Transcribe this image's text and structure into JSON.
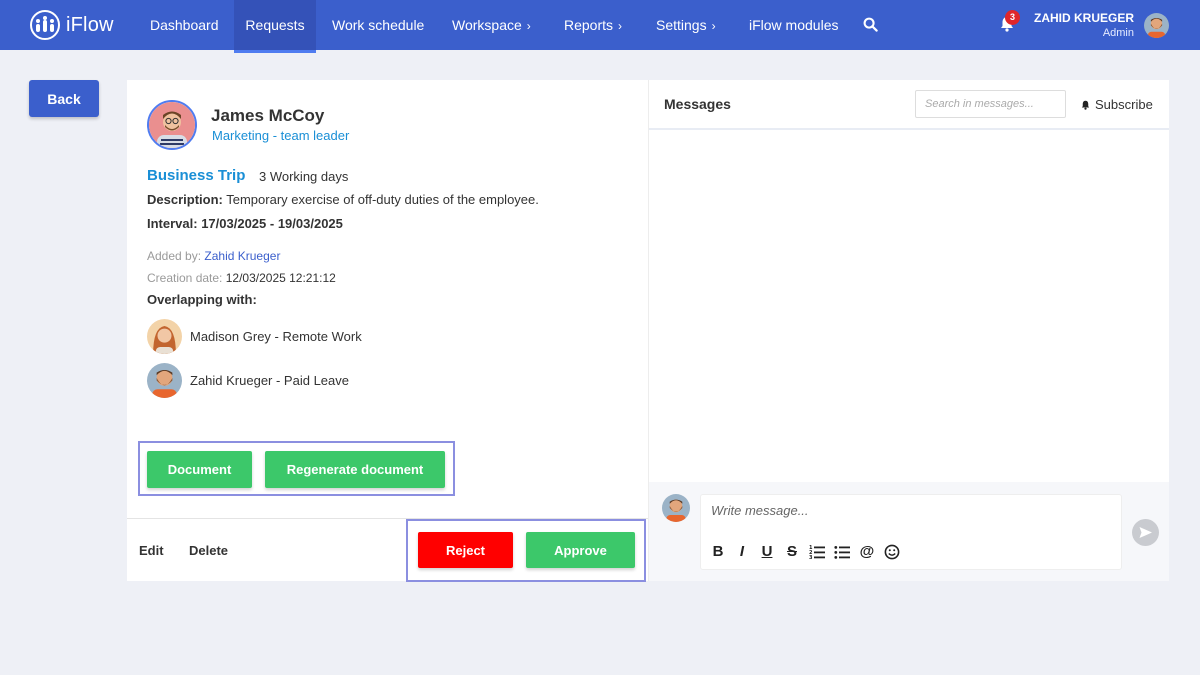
{
  "app": {
    "name": "iFlow"
  },
  "nav": {
    "items": [
      {
        "label": "Dashboard",
        "has_chevron": false,
        "active": false
      },
      {
        "label": "Requests",
        "has_chevron": false,
        "active": true
      },
      {
        "label": "Work schedule",
        "has_chevron": false,
        "active": false
      },
      {
        "label": "Workspace",
        "has_chevron": true,
        "active": false
      },
      {
        "label": "Reports",
        "has_chevron": true,
        "active": false
      },
      {
        "label": "Settings",
        "has_chevron": true,
        "active": false
      },
      {
        "label": "iFlow modules",
        "has_chevron": false,
        "active": false
      }
    ],
    "chevron_glyph": "›",
    "notification_count": "3",
    "user": {
      "name": "ZAHID KRUEGER",
      "role": "Admin"
    }
  },
  "back_label": "Back",
  "request": {
    "employee_name": "James McCoy",
    "employee_role": "Marketing - team leader",
    "type": "Business Trip",
    "duration": "3 Working days",
    "description_label": "Description:",
    "description": "Temporary exercise of off-duty duties of the employee.",
    "interval_label": "Interval:",
    "interval": "17/03/2025 - 19/03/2025",
    "added_by_label": "Added by:",
    "added_by": "Zahid Krueger",
    "creation_label": "Creation date:",
    "creation_date": "12/03/2025 12:21:12",
    "overlap_label": "Overlapping with:",
    "overlaps": [
      {
        "text": "Madison Grey - Remote Work"
      },
      {
        "text": "Zahid Krueger - Paid Leave"
      }
    ]
  },
  "actions": {
    "document": "Document",
    "regenerate": "Regenerate document",
    "edit": "Edit",
    "delete": "Delete",
    "reject": "Reject",
    "approve": "Approve"
  },
  "messages": {
    "title": "Messages",
    "search_placeholder": "Search in messages...",
    "subscribe": "Subscribe",
    "compose_placeholder": "Write message..."
  },
  "toolbar": {
    "bold": "B",
    "italic": "I",
    "underline": "U",
    "strike": "S",
    "mention": "@"
  },
  "colors": {
    "nav_bg": "#3b5fcc",
    "accent_blue": "#1a8fd6",
    "approve_green": "#3cc86a",
    "reject_red": "#ff0000",
    "highlight_border": "#8b8fe0"
  }
}
